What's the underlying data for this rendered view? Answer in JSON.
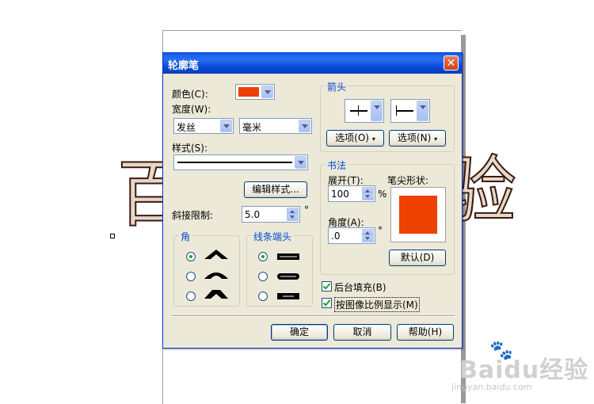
{
  "dialog": {
    "title": "轮廓笔",
    "color_label": "颜色(C):",
    "color_value": "#ee4000",
    "width_label": "宽度(W):",
    "width_value": "发丝",
    "unit_value": "毫米",
    "style_label": "样式(S):",
    "edit_style_button": "编辑样式...",
    "miter_label": "斜接限制:",
    "miter_value": "5.0",
    "miter_unit": "°",
    "corners_title": "角",
    "caps_title": "线条端头",
    "corner_selected": 0,
    "cap_selected": 0,
    "arrows_title": "箭头",
    "arrow_options_left": "选项(O)",
    "arrow_options_right": "选项(N)",
    "calligraphy_title": "书法",
    "stretch_label": "展开(T):",
    "stretch_value": "100",
    "stretch_unit": "%",
    "nib_shape_label": "笔尖形状:",
    "angle_label": "角度(A):",
    "angle_value": ".0",
    "angle_unit": "°",
    "default_button": "默认(D)",
    "behind_fill_label": "后台填充(B)",
    "behind_fill_checked": true,
    "scale_label": "按图像比例显示(M)",
    "scale_checked": true,
    "ok_button": "确定",
    "cancel_button": "取消",
    "help_button": "帮助(H)"
  },
  "canvas": {
    "left_char": "百",
    "right_char": "验"
  },
  "watermark": {
    "main": "Baidu经验",
    "sub": "jingyan.baidu.com"
  },
  "colors": {
    "nib": "#ee4000",
    "title_bar": "#0a5fe8",
    "group_title": "#0046d5"
  }
}
